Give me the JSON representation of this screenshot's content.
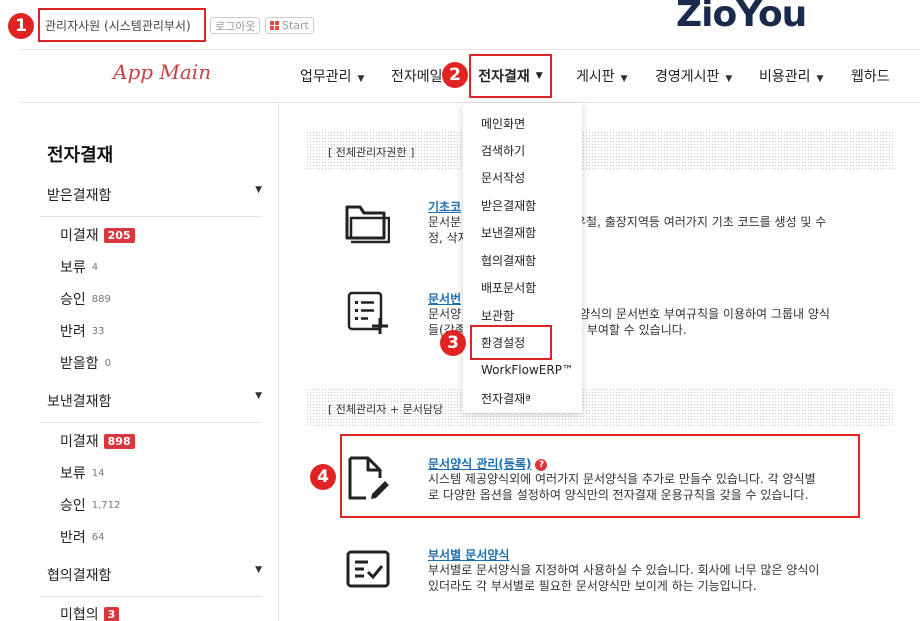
{
  "top": {
    "user_label": "관리자사원 (시스템관리부서)",
    "logout_label": "로그아웃",
    "start_label": "Start",
    "brand_logo": "ZioYou"
  },
  "markers": [
    "1",
    "2",
    "3",
    "4"
  ],
  "nav": {
    "app_logo": "App Main",
    "items": [
      {
        "label": "업무관리"
      },
      {
        "label": "전자메일"
      },
      {
        "label": "전자결재"
      },
      {
        "label": "게시판"
      },
      {
        "label": "경영게시판"
      },
      {
        "label": "비용관리"
      },
      {
        "label": "웹하드"
      }
    ]
  },
  "dropdown": {
    "items": [
      "메인화면",
      "검색하기",
      "문서작성",
      "받은결재함",
      "보낸결재함",
      "협의결재함",
      "배포문서함",
      "보관함",
      "환경설정",
      "WorkFlowERP™",
      "전자결재ª"
    ]
  },
  "sidebar": {
    "title": "전자결재",
    "groups": [
      {
        "label": "받은결재함",
        "items": [
          {
            "label": "미결재",
            "badge": "205"
          },
          {
            "label": "보류",
            "count": "4"
          },
          {
            "label": "승인",
            "count": "889"
          },
          {
            "label": "반려",
            "count": "33"
          },
          {
            "label": "받을함",
            "count": "0"
          }
        ]
      },
      {
        "label": "보낸결재함",
        "items": [
          {
            "label": "미결재",
            "badge": "898"
          },
          {
            "label": "보류",
            "count": "14"
          },
          {
            "label": "승인",
            "count": "1,712"
          },
          {
            "label": "반려",
            "count": "64"
          }
        ]
      },
      {
        "label": "협의결재함",
        "items": [
          {
            "label": "미협의",
            "badge": "3"
          }
        ]
      }
    ]
  },
  "main": {
    "section1": "[ 전체관리자권한 ]",
    "section2": "[ 전체관리자 + 문서담당",
    "items": [
      {
        "title": "기초코",
        "desc1": "문서분",
        "desc1b": "우철, 출장지역등 여러가지 기초 코드를 생성 및 수",
        "desc2": "정, 삭자"
      },
      {
        "title": "문서번",
        "desc1": "문서양",
        "desc1b": "양식의 문서번호 부여규칙을 이용하여 그룹내 양식",
        "desc2": "들(각종",
        "desc2b": "를 부여할 수 있습니다."
      },
      {
        "title": "문서양식 관리(등록)",
        "help": "?",
        "desc1": "시스템 제공양식외에 여러가지 문서양식을 추가로 만들수 있습니다. 각 양식별",
        "desc2": "로 다양한 옵션을 설정하여 양식만의 전자결재 운용규칙을 갖을 수 있습니다."
      },
      {
        "title": "부서별 문서양식",
        "desc1": "부서별로 문서양식을 지정하여 사용하실 수 있습니다. 회사에 너무 많은 양식이",
        "desc2": "있더라도 각 부서별로 필요한 문서양식만 보이게 하는 기능입니다."
      }
    ]
  },
  "colors": {
    "accent": "#e02424",
    "badge": "#d9363e",
    "link": "#1d6fb0"
  }
}
